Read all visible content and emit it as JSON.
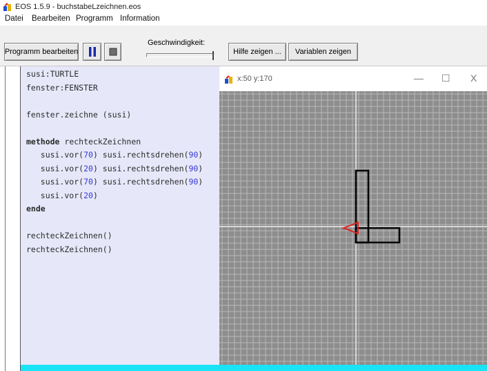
{
  "window": {
    "title": "EOS 1.5.9 - buchstabeLzeichnen.eos"
  },
  "menu": {
    "items": [
      "Datei",
      "Bearbeiten",
      "Programm",
      "Information"
    ]
  },
  "toolbar": {
    "edit_program_label": "Programm bearbeiten",
    "pause_icon": "pause-icon",
    "stop_icon": "stop-icon",
    "speed_label": "Geschwindigkeit:",
    "speed_value": 1.0,
    "help_label": "Hilfe zeigen ...",
    "variables_label": "Variablen zeigen"
  },
  "editor": {
    "lines": [
      "susi:TURTLE",
      "fenster:FENSTER",
      "",
      "fenster.zeichne (susi)",
      "",
      "methode rechteckZeichnen",
      "   susi.vor(70) susi.rechtsdrehen(90)",
      "   susi.vor(20) susi.rechtsdrehen(90)",
      "   susi.vor(70) susi.rechtsdrehen(90)",
      "   susi.vor(20)",
      "ende",
      "",
      "rechteckZeichnen()",
      "rechteckZeichnen()"
    ]
  },
  "turtle_window": {
    "coords": "x:50 y:170",
    "minimize": "—",
    "maximize": "☐",
    "close": "X"
  },
  "colors": {
    "editor_bg": "#e6e8f9",
    "canvas_bg": "#8d8d8d",
    "grid": "#b9b9b9",
    "turtle": "#e02020",
    "status_accent": "#19e3f5"
  }
}
